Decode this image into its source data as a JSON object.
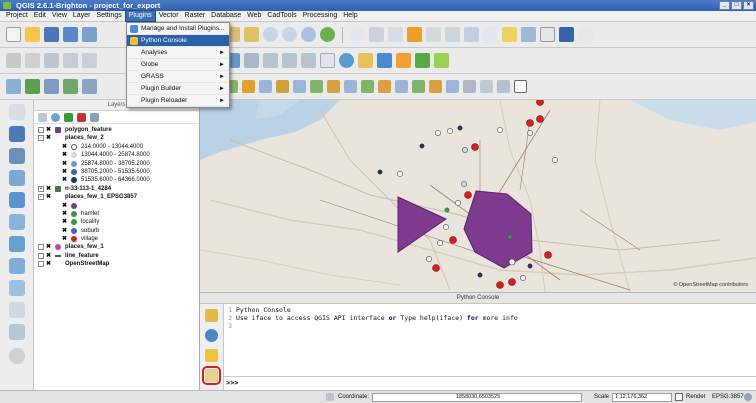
{
  "window": {
    "title": "QGIS 2.6.1-Brighton - project_for_export",
    "controls": [
      "_",
      "□",
      "×"
    ]
  },
  "menubar": [
    "Project",
    "Edit",
    "View",
    "Layer",
    "Settings",
    "Plugins",
    "Vector",
    "Raster",
    "Database",
    "Web",
    "CadTools",
    "Processing",
    "Help"
  ],
  "active_menu": "Plugins",
  "plugins_menu": {
    "items": [
      {
        "label": "Manage and Install Plugins...",
        "submenu": false,
        "icon_color": "#4a8fd0"
      },
      {
        "label": "Python Console",
        "submenu": false,
        "selected": true,
        "icon_color": "#f2c230"
      },
      {
        "label": "Analyses",
        "submenu": true
      },
      {
        "label": "Globe",
        "submenu": true
      },
      {
        "label": "GRASS",
        "submenu": true
      },
      {
        "label": "Plugin Builder",
        "submenu": true
      },
      {
        "label": "Plugin Reloader",
        "submenu": true
      }
    ]
  },
  "layers_panel": {
    "header": "Layers"
  },
  "layers": [
    {
      "label": "polygon_feature",
      "indent": 0,
      "bold": true,
      "expand": "",
      "symbol": "#7d3a8e",
      "symbol_shape": "square"
    },
    {
      "label": "places_few_2",
      "indent": 0,
      "bold": true,
      "expand": "-",
      "symbol": ""
    },
    {
      "label": "214.0000 - 13044.4000",
      "indent": 1,
      "symbol": "#ffffff"
    },
    {
      "label": "13044.4000 - 25874.8000",
      "indent": 1,
      "symbol": "#c9d9ea"
    },
    {
      "label": "25874.8000 - 38705.2000",
      "indent": 1,
      "symbol": "#6b9bc9"
    },
    {
      "label": "38705.2000 - 51535.6000",
      "indent": 1,
      "symbol": "#2c6aa8"
    },
    {
      "label": "51535.6000 - 64366.0000",
      "indent": 1,
      "symbol": "#0b3a78"
    },
    {
      "label": "n-33-113-1_4284",
      "indent": 0,
      "bold": true,
      "expand": "+",
      "symbol": "#3a7a3a",
      "symbol_shape": "square"
    },
    {
      "label": "places_few_1_EPSG3857",
      "indent": 0,
      "bold": true,
      "expand": "-",
      "symbol": ""
    },
    {
      "label": "",
      "indent": 1,
      "symbol": "#7d3a8e"
    },
    {
      "label": "hamlet",
      "indent": 1,
      "symbol": "#3a9a3a"
    },
    {
      "label": "locality",
      "indent": 1,
      "symbol": "#3a9a3a"
    },
    {
      "label": "suburb",
      "indent": 1,
      "symbol": "#4a5fc0"
    },
    {
      "label": "village",
      "indent": 1,
      "symbol": "#d42020"
    },
    {
      "label": "places_few_1",
      "indent": 0,
      "bold": true,
      "expand": "",
      "symbol": "#c040c0"
    },
    {
      "label": "line_feature",
      "indent": 0,
      "bold": true,
      "expand": "",
      "symbol": "#555555",
      "symbol_shape": "line"
    },
    {
      "label": "OpenStreetMap",
      "indent": 0,
      "bold": true,
      "expand": "",
      "symbol": ""
    }
  ],
  "python_console": {
    "header": "Python Console",
    "lines": [
      {
        "n": "1",
        "text": "Python Console"
      },
      {
        "n": "2",
        "pre": "Use iface to access QGIS API interface ",
        "kw1": "or",
        "mid": " Type help(iface) ",
        "kw2": "for",
        "post": " more info"
      },
      {
        "n": "3",
        "text": ""
      }
    ],
    "prompt": ">>>"
  },
  "statusbar": {
    "coordinate_label": "Coordinate:",
    "coordinate_value": "1858030,6503525",
    "scale_label": "Scale",
    "scale_value": "1:12,176,362",
    "render_label": "Render",
    "crs": "EPSG:3857"
  },
  "map": {
    "attribution": "© OpenStreetMap contributors",
    "colors": {
      "polygon": "#7d3a8e",
      "village": "#d42020",
      "suburb": "#24356e",
      "hamlet": "#3a9a3a"
    }
  }
}
